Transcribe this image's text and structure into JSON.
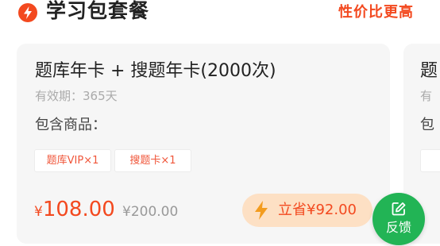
{
  "header": {
    "icon": "lightning-icon",
    "title": "学习包套餐",
    "slogan": "性价比更高"
  },
  "package": {
    "title": "题库年卡 + 搜题年卡(2000次)",
    "validity": "有效期：365天",
    "includes_label": "包含商品：",
    "tags": [
      "题库VIP×1",
      "搜题卡×1"
    ],
    "currency": "¥",
    "price": "108.00",
    "original_price": "¥200.00",
    "save_text": "立省¥92.00",
    "save_icon": "lightning-icon"
  },
  "next_package": {
    "title": "题",
    "validity": "有",
    "includes_label": "包"
  },
  "feedback": {
    "icon": "edit-icon",
    "label": "反馈"
  },
  "colors": {
    "accent": "#f3491f",
    "tag_text": "#f0563a",
    "save_pill": "#fde0c4",
    "feedback_green": "#22b455",
    "card_bg": "#f6f6f6"
  }
}
